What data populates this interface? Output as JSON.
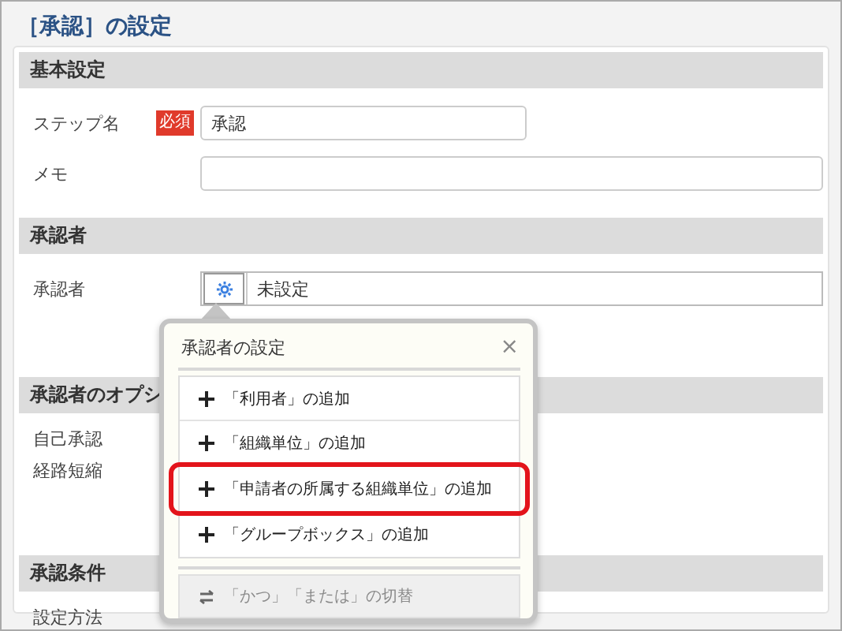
{
  "title": "［承認］の設定",
  "sections": [
    {
      "heading": "基本設定",
      "rows": [
        {
          "kind": "text",
          "label": "ステップ名",
          "required_badge": "必須",
          "value": "承認"
        },
        {
          "kind": "text",
          "label": "メモ",
          "value": ""
        }
      ]
    },
    {
      "heading": "承認者",
      "rows": [
        {
          "kind": "picker",
          "label": "承認者",
          "value": "未設定"
        }
      ]
    },
    {
      "heading": "承認者のオプシ",
      "rows": [
        {
          "kind": "plain",
          "label": "自己承認"
        },
        {
          "kind": "plain",
          "label": "経路短縮"
        }
      ]
    },
    {
      "heading": "承認条件",
      "rows": [
        {
          "kind": "plain",
          "label": "設定方法"
        }
      ]
    }
  ],
  "popup": {
    "title": "承認者の設定",
    "close": "×",
    "items": [
      {
        "kind": "add",
        "label": "「利用者」の追加",
        "highlighted": false,
        "disabled": false
      },
      {
        "kind": "add",
        "label": "「組織単位」の追加",
        "highlighted": false,
        "disabled": false
      },
      {
        "kind": "add",
        "label": "「申請者の所属する組織単位」の追加",
        "highlighted": true,
        "disabled": false
      },
      {
        "kind": "add",
        "label": "「グループボックス」の追加",
        "highlighted": false,
        "disabled": false
      },
      {
        "kind": "toggle",
        "label": "「かつ」「または」の切替",
        "highlighted": false,
        "disabled": true
      }
    ]
  }
}
